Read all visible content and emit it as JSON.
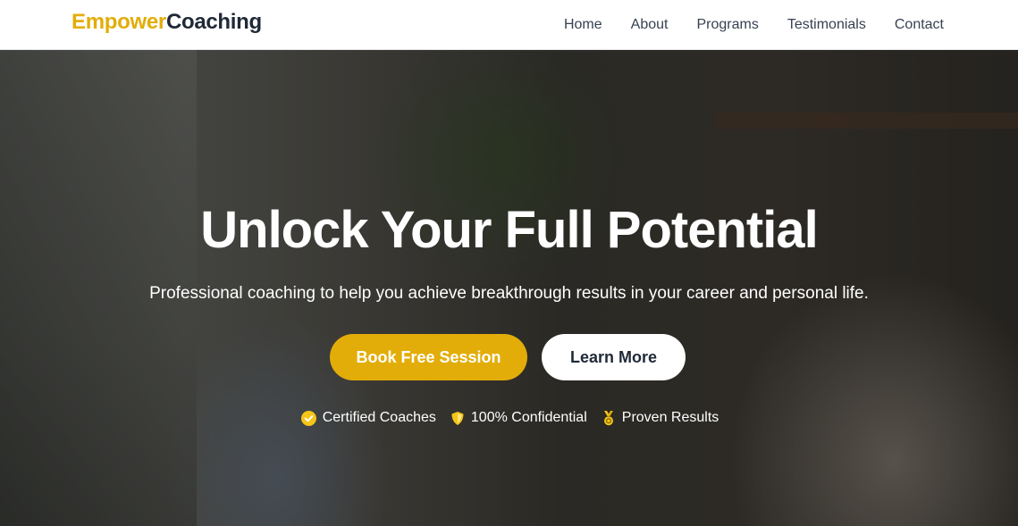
{
  "logo": {
    "part1": "Empower",
    "part2": "Coaching"
  },
  "nav": {
    "items": [
      {
        "label": "Home"
      },
      {
        "label": "About"
      },
      {
        "label": "Programs"
      },
      {
        "label": "Testimonials"
      },
      {
        "label": "Contact"
      }
    ]
  },
  "hero": {
    "title": "Unlock Your Full Potential",
    "subtitle": "Professional coaching to help you achieve breakthrough results in your career and personal life.",
    "primary_button": "Book Free Session",
    "secondary_button": "Learn More",
    "badges": [
      {
        "icon": "check-circle-icon",
        "label": "Certified Coaches"
      },
      {
        "icon": "shield-icon",
        "label": "100% Confidential"
      },
      {
        "icon": "medal-icon",
        "label": "Proven Results"
      }
    ]
  },
  "colors": {
    "accent": "#e3ad09",
    "text_dark": "#1f2937",
    "nav_text": "#374151"
  }
}
